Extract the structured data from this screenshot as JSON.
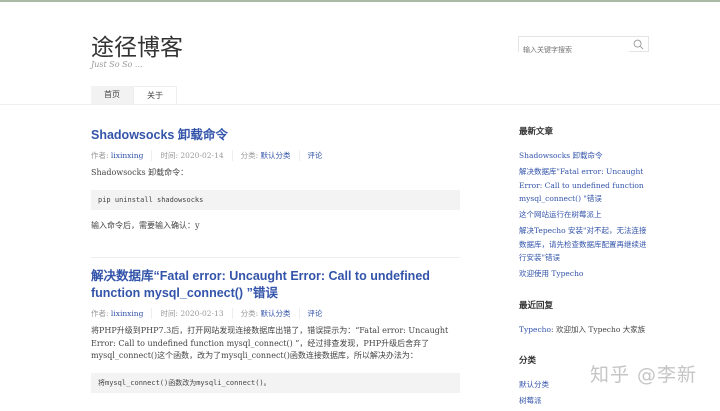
{
  "site": {
    "title": "途径博客",
    "description": "Just So So ...",
    "search_placeholder": "输入关键字搜索"
  },
  "nav": [
    {
      "label": "首页"
    },
    {
      "label": "关于"
    }
  ],
  "posts": [
    {
      "title": "Shadowsocks 卸载命令",
      "author_label": "作者: ",
      "author": "lixinxing",
      "time": "时间: 2020-02-14",
      "category_label": "分类: ",
      "category": "默认分类",
      "comments": "评论",
      "p1": "Shadowsocks 卸载命令：",
      "code": "pip uninstall shadowsocks",
      "p2": "输入命令后，需要输入确认：y"
    },
    {
      "title": "解决数据库“Fatal error: Uncaught Error: Call to undefined function mysql_connect() ”错误",
      "author_label": "作者: ",
      "author": "lixinxing",
      "time": "时间: 2020-02-13",
      "category_label": "分类: ",
      "category": "默认分类",
      "comments": "评论",
      "p1": "将PHP升级到PHP7.3后，打开网站发现连接数据库出错了，错误提示为：“Fatal error: Uncaught Error: Call to undefined function mysql_connect() ”，经过排查发现，PHP升级后舍弃了mysql_connect()这个函数，改为了mysqli_connect()函数连接数据库，所以解决办法为：",
      "code": "将mysql_connect()函数改为mysqli_connect()。"
    }
  ],
  "sidebar": {
    "recent_posts_title": "最新文章",
    "recent_posts": [
      "Shadowsocks 卸载命令",
      "解决数据库\"Fatal error: Uncaught Error: Call to undefined function mysql_connect() \"错误",
      "这个网站运行在树莓派上",
      "解决Tepecho 安装\"对不起，无法连接数据库，请先检查数据库配置再继续进行安装\"错误",
      "欢迎使用 Typecho"
    ],
    "recent_comments_title": "最近回复",
    "comment_author": "Typecho",
    "comment_text": ": 欢迎加入 Typecho 大家族",
    "categories_title": "分类",
    "categories": [
      "默认分类",
      "树莓派"
    ]
  },
  "watermark": "知乎 @李新"
}
